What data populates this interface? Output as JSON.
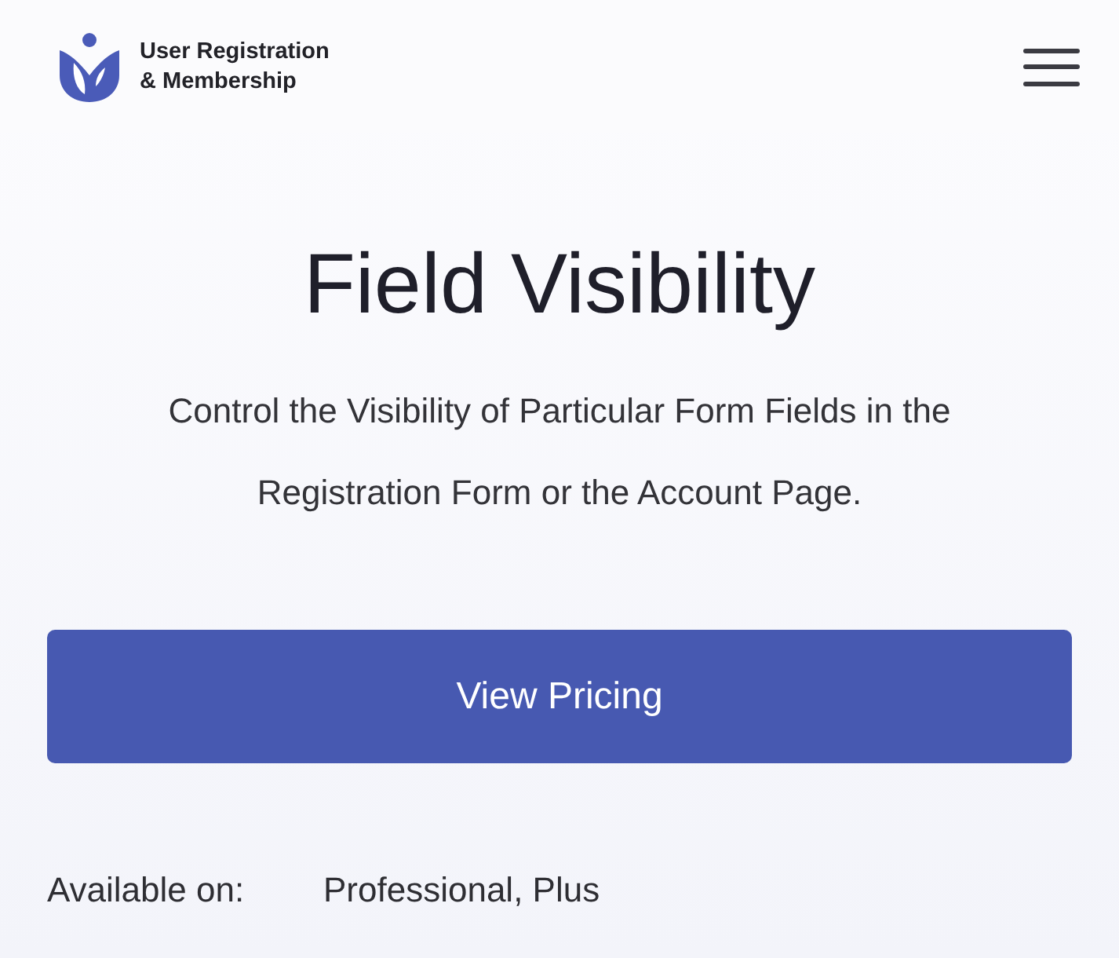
{
  "header": {
    "logo_text": [
      "User Registration",
      "& Membership"
    ]
  },
  "page": {
    "title": "Field Visibility",
    "description": "Control the Visibility of Particular Form Fields in the Registration Form or the Account Page.",
    "button": "View Pricing",
    "availability": {
      "label": "Available on:",
      "value": "Professional, Plus"
    }
  }
}
